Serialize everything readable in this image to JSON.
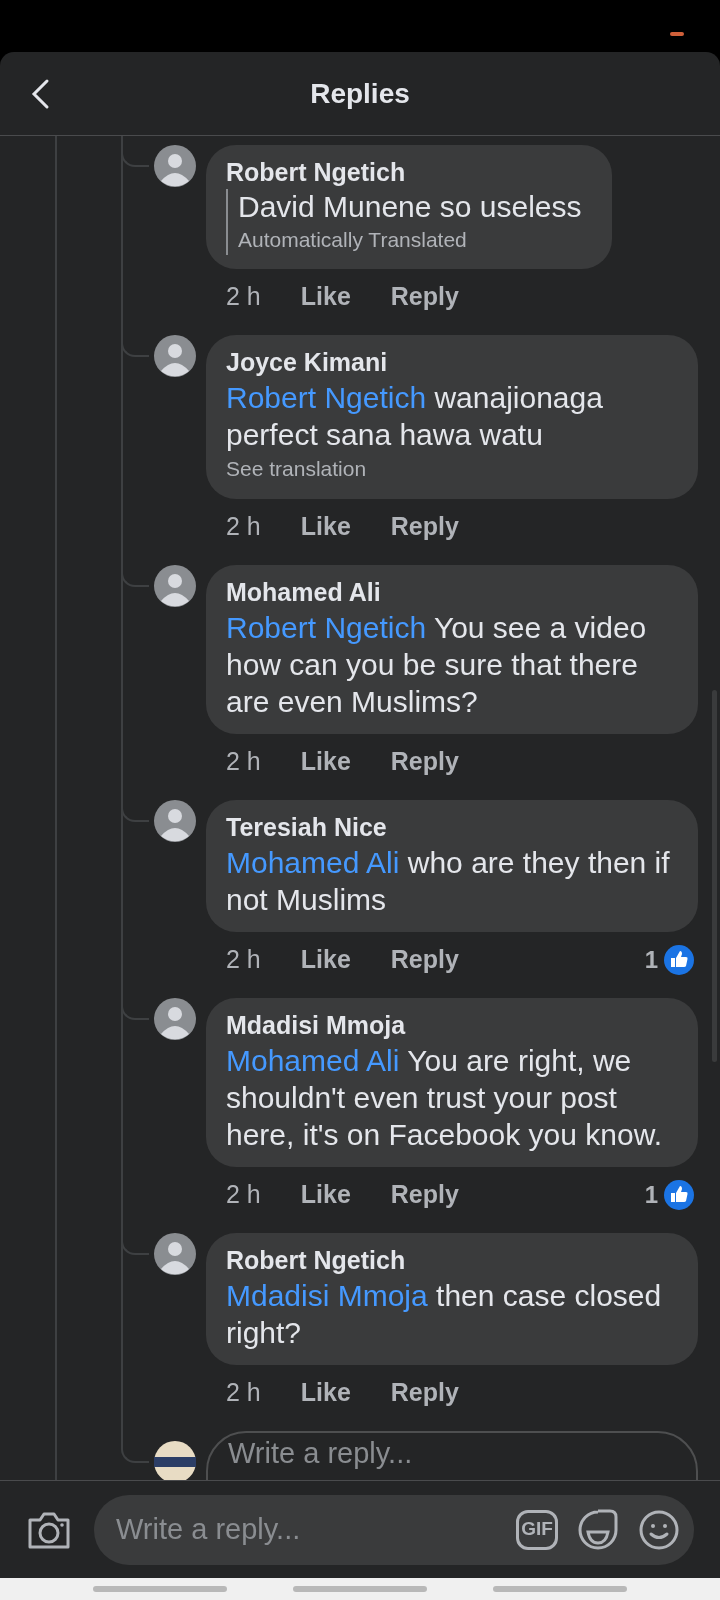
{
  "header": {
    "title": "Replies"
  },
  "comments": [
    {
      "author": "Robert Ngetich",
      "text": "David Munene so useless",
      "note": "Automatically Translated",
      "kind": "translated",
      "time": "2 h",
      "like": "Like",
      "reply": "Reply"
    },
    {
      "author": "Joyce Kimani",
      "mention": "Robert Ngetich",
      "text": "wanajionaga perfect sana hawa watu",
      "note": "See translation",
      "kind": "translatable",
      "time": "2 h",
      "like": "Like",
      "reply": "Reply"
    },
    {
      "author": "Mohamed Ali",
      "mention": "Robert Ngetich",
      "text": " You see a video how can you be sure that there are even Muslims?",
      "kind": "plain",
      "time": "2 h",
      "like": "Like",
      "reply": "Reply"
    },
    {
      "author": "Teresiah Nice",
      "mention": "Mohamed Ali",
      "text": "who are they then if not Muslims",
      "kind": "plain",
      "time": "2 h",
      "like": "Like",
      "reply": "Reply",
      "reactions": "1"
    },
    {
      "author": "Mdadisi Mmoja",
      "mention": "Mohamed Ali",
      "text": "You are right, we shouldn't even trust your post here, it's on Facebook you know.",
      "kind": "plain",
      "time": "2 h",
      "like": "Like",
      "reply": "Reply",
      "reactions": "1"
    },
    {
      "author": "Robert Ngetich",
      "mention": "Mdadisi Mmoja",
      "text": "then case closed right?",
      "kind": "plain",
      "time": "2 h",
      "like": "Like",
      "reply": "Reply"
    }
  ],
  "inline_reply": {
    "placeholder": "Write a reply..."
  },
  "composer": {
    "placeholder": "Write a reply...",
    "gif": "GIF"
  }
}
